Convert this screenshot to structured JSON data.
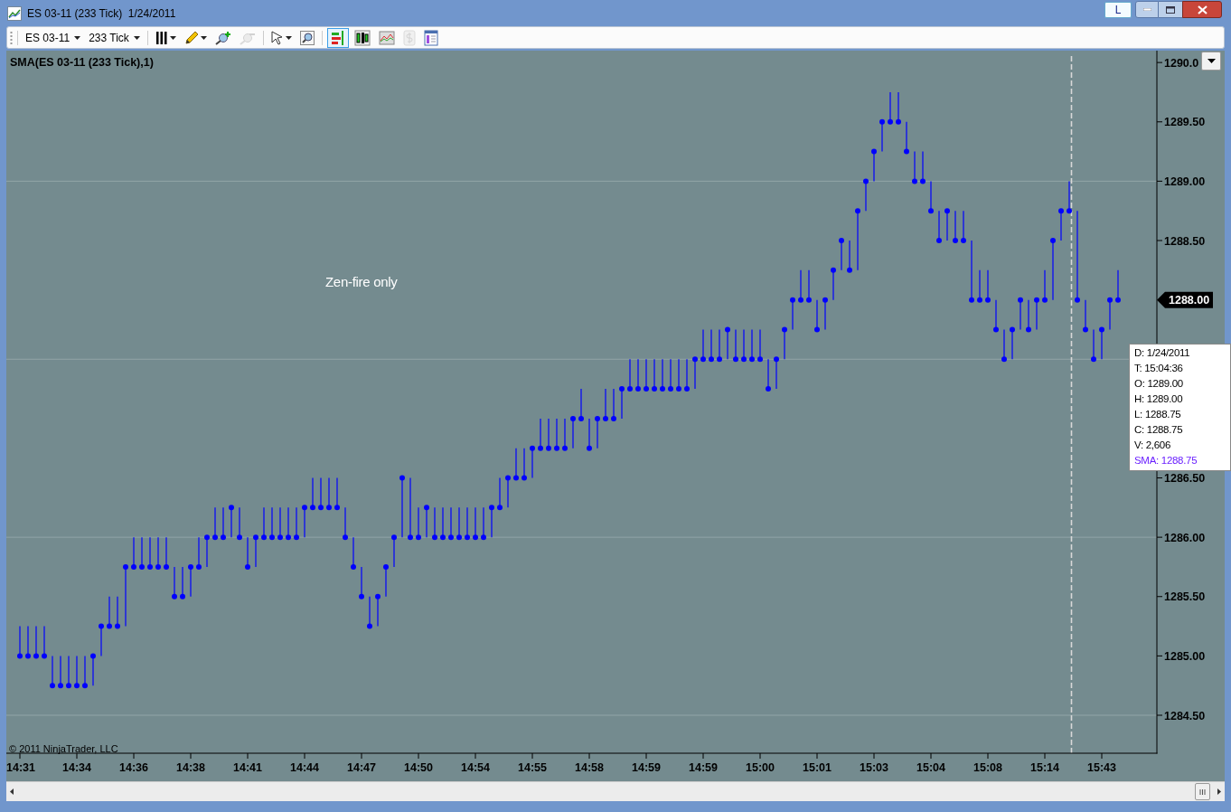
{
  "window": {
    "title": "ES 03-11 (233 Tick)  1/24/2011",
    "l_button": "L"
  },
  "toolbar": {
    "instrument": "ES 03-11",
    "period": "233 Tick",
    "tools": [
      {
        "selected": false,
        "disabled": false
      },
      {
        "selected": false,
        "disabled": false
      },
      {
        "selected": false,
        "disabled": false
      },
      {
        "selected": false,
        "disabled": true
      },
      {
        "selected": false,
        "disabled": false
      },
      {
        "selected": false,
        "disabled": false
      },
      {
        "selected": true,
        "disabled": false
      },
      {
        "selected": false,
        "disabled": false
      },
      {
        "selected": false,
        "disabled": false
      },
      {
        "selected": false,
        "disabled": true
      },
      {
        "selected": false,
        "disabled": false
      }
    ]
  },
  "chart": {
    "indicator_label": "SMA(ES 03-11 (233 Tick),1)",
    "note": "Zen-fire only",
    "copyright": "© 2011 NinjaTrader, LLC",
    "last_price": "1288.00",
    "chart_data": {
      "type": "scatter",
      "ylim": [
        1284.18,
        1290.1
      ],
      "categories": [
        "14:31",
        null,
        null,
        null,
        null,
        null,
        null,
        "14:34",
        null,
        null,
        null,
        null,
        null,
        null,
        "14:36",
        null,
        null,
        null,
        null,
        null,
        null,
        "14:38",
        null,
        null,
        null,
        null,
        null,
        null,
        "14:41",
        null,
        null,
        null,
        null,
        null,
        null,
        "14:44",
        null,
        null,
        null,
        null,
        null,
        null,
        "14:47",
        null,
        null,
        null,
        null,
        null,
        null,
        "14:50",
        null,
        null,
        null,
        null,
        null,
        null,
        "14:54",
        null,
        null,
        null,
        null,
        null,
        null,
        "14:55",
        null,
        null,
        null,
        null,
        null,
        null,
        "14:58",
        null,
        null,
        null,
        null,
        null,
        null,
        "14:59",
        null,
        null,
        null,
        null,
        null,
        null,
        "14:59",
        null,
        null,
        null,
        null,
        null,
        null,
        "15:00",
        null,
        null,
        null,
        null,
        null,
        null,
        "15:01",
        null,
        null,
        null,
        null,
        null,
        null,
        "15:03",
        null,
        null,
        null,
        null,
        null,
        null,
        "15:04",
        null,
        null,
        null,
        null,
        null,
        null,
        "15:08",
        null,
        null,
        null,
        null,
        null,
        null,
        "15:14",
        null,
        null,
        null,
        null,
        null,
        null,
        "15:43",
        null,
        null
      ],
      "yticks": [
        {
          "value": 1290,
          "label": "1290.0"
        },
        {
          "value": 1289.5,
          "label": "1289.50"
        },
        {
          "value": 1289,
          "label": "1289.00"
        },
        {
          "value": 1288.5,
          "label": "1288.50"
        },
        {
          "value": 1286.5,
          "label": "1286.50"
        },
        {
          "value": 1286,
          "label": "1286.00"
        },
        {
          "value": 1285.5,
          "label": "1285.50"
        },
        {
          "value": 1285,
          "label": "1285.00"
        },
        {
          "value": 1284.5,
          "label": "1284.50"
        }
      ],
      "grid": true,
      "series": [
        {
          "color": "#0000ff",
          "values": [
            1285,
            1285,
            1285,
            1285,
            1284.75,
            1284.75,
            1284.75,
            1284.75,
            1284.75,
            1285,
            1285.25,
            1285.25,
            1285.25,
            1285.75,
            1285.75,
            1285.75,
            1285.75,
            1285.75,
            1285.75,
            1285.5,
            1285.5,
            1285.75,
            1285.75,
            1286,
            1286,
            1286,
            1286.25,
            1286,
            1285.75,
            1286,
            1286,
            1286,
            1286,
            1286,
            1286,
            1286.25,
            1286.25,
            1286.25,
            1286.25,
            1286.25,
            1286,
            1285.75,
            1285.5,
            1285.25,
            1285.5,
            1285.75,
            1286,
            1286.5,
            1286,
            1286,
            1286.25,
            1286,
            1286,
            1286,
            1286,
            1286,
            1286,
            1286,
            1286.25,
            1286.25,
            1286.5,
            1286.5,
            1286.5,
            1286.75,
            1286.75,
            1286.75,
            1286.75,
            1286.75,
            1287,
            1287,
            1286.75,
            1287,
            1287,
            1287,
            1287.25,
            1287.25,
            1287.25,
            1287.25,
            1287.25,
            1287.25,
            1287.25,
            1287.25,
            1287.25,
            1287.5,
            1287.5,
            1287.5,
            1287.5,
            1287.75,
            1287.5,
            1287.5,
            1287.5,
            1287.5,
            1287.25,
            1287.5,
            1287.75,
            1288,
            1288,
            1288,
            1287.75,
            1288,
            1288.25,
            1288.5,
            1288.25,
            1288.75,
            1289,
            1289.25,
            1289.5,
            1289.5,
            1289.5,
            1289.25,
            1289,
            1289,
            1288.75,
            1288.5,
            1288.75,
            1288.5,
            1288.5,
            1288,
            1288,
            1288,
            1287.75,
            1287.5,
            1287.75,
            1288,
            1287.75,
            1288,
            1288,
            1288.5,
            1288.75,
            1288.75,
            1288,
            1287.75,
            1287.5,
            1287.75,
            1288,
            1288
          ],
          "errors": [
            [
              1285,
              1285.25
            ],
            [
              1285,
              1285.25
            ],
            [
              1285,
              1285.25
            ],
            [
              1285,
              1285.25
            ],
            [
              1284.75,
              1285
            ],
            [
              1284.75,
              1285
            ],
            [
              1284.75,
              1285
            ],
            [
              1284.75,
              1285
            ],
            [
              1284.75,
              1285
            ],
            [
              1284.75,
              1285
            ],
            [
              1285,
              1285.25
            ],
            [
              1285.25,
              1285.5
            ],
            [
              1285.25,
              1285.5
            ],
            [
              1285.25,
              1285.75
            ],
            [
              1285.75,
              1286
            ],
            [
              1285.75,
              1286
            ],
            [
              1285.75,
              1286
            ],
            [
              1285.75,
              1286
            ],
            [
              1285.75,
              1286
            ],
            [
              1285.5,
              1285.75
            ],
            [
              1285.5,
              1285.75
            ],
            [
              1285.5,
              1285.75
            ],
            [
              1285.75,
              1286
            ],
            [
              1285.75,
              1286
            ],
            [
              1286,
              1286.25
            ],
            [
              1286,
              1286.25
            ],
            [
              1286,
              1286.25
            ],
            [
              1286,
              1286.25
            ],
            [
              1285.75,
              1286
            ],
            [
              1285.75,
              1286
            ],
            [
              1286,
              1286.25
            ],
            [
              1286,
              1286.25
            ],
            [
              1286,
              1286.25
            ],
            [
              1286,
              1286.25
            ],
            [
              1286,
              1286.25
            ],
            [
              1286,
              1286.25
            ],
            [
              1286.25,
              1286.5
            ],
            [
              1286.25,
              1286.5
            ],
            [
              1286.25,
              1286.5
            ],
            [
              1286.25,
              1286.5
            ],
            [
              1286,
              1286.25
            ],
            [
              1285.75,
              1286
            ],
            [
              1285.5,
              1285.75
            ],
            [
              1285.25,
              1285.5
            ],
            [
              1285.25,
              1285.5
            ],
            [
              1285.5,
              1285.75
            ],
            [
              1285.75,
              1286
            ],
            [
              1286,
              1286.5
            ],
            [
              1286,
              1286.5
            ],
            [
              1286,
              1286.25
            ],
            [
              1286,
              1286.25
            ],
            [
              1286,
              1286.25
            ],
            [
              1286,
              1286.25
            ],
            [
              1286,
              1286.25
            ],
            [
              1286,
              1286.25
            ],
            [
              1286,
              1286.25
            ],
            [
              1286,
              1286.25
            ],
            [
              1286,
              1286.25
            ],
            [
              1286,
              1286.25
            ],
            [
              1286.25,
              1286.5
            ],
            [
              1286.25,
              1286.5
            ],
            [
              1286.5,
              1286.75
            ],
            [
              1286.5,
              1286.75
            ],
            [
              1286.5,
              1286.75
            ],
            [
              1286.75,
              1287
            ],
            [
              1286.75,
              1287
            ],
            [
              1286.75,
              1287
            ],
            [
              1286.75,
              1287
            ],
            [
              1286.75,
              1287
            ],
            [
              1287,
              1287.25
            ],
            [
              1286.75,
              1287
            ],
            [
              1286.75,
              1287
            ],
            [
              1287,
              1287.25
            ],
            [
              1287,
              1287.25
            ],
            [
              1287,
              1287.25
            ],
            [
              1287.25,
              1287.5
            ],
            [
              1287.25,
              1287.5
            ],
            [
              1287.25,
              1287.5
            ],
            [
              1287.25,
              1287.5
            ],
            [
              1287.25,
              1287.5
            ],
            [
              1287.25,
              1287.5
            ],
            [
              1287.25,
              1287.5
            ],
            [
              1287.25,
              1287.5
            ],
            [
              1287.25,
              1287.5
            ],
            [
              1287.5,
              1287.75
            ],
            [
              1287.5,
              1287.75
            ],
            [
              1287.5,
              1287.75
            ],
            [
              1287.5,
              1287.75
            ],
            [
              1287.5,
              1287.75
            ],
            [
              1287.5,
              1287.75
            ],
            [
              1287.5,
              1287.75
            ],
            [
              1287.5,
              1287.75
            ],
            [
              1287.25,
              1287.5
            ],
            [
              1287.25,
              1287.5
            ],
            [
              1287.5,
              1287.75
            ],
            [
              1287.75,
              1288
            ],
            [
              1288,
              1288.25
            ],
            [
              1288,
              1288.25
            ],
            [
              1287.75,
              1288
            ],
            [
              1287.75,
              1288
            ],
            [
              1288,
              1288.25
            ],
            [
              1288.25,
              1288.5
            ],
            [
              1288.25,
              1288.5
            ],
            [
              1288.25,
              1288.75
            ],
            [
              1288.75,
              1289
            ],
            [
              1289,
              1289.25
            ],
            [
              1289.25,
              1289.5
            ],
            [
              1289.5,
              1289.75
            ],
            [
              1289.5,
              1289.75
            ],
            [
              1289.25,
              1289.5
            ],
            [
              1289,
              1289.25
            ],
            [
              1289,
              1289.25
            ],
            [
              1288.75,
              1289
            ],
            [
              1288.5,
              1288.75
            ],
            [
              1288.5,
              1288.75
            ],
            [
              1288.5,
              1288.75
            ],
            [
              1288.5,
              1288.75
            ],
            [
              1288,
              1288.5
            ],
            [
              1288,
              1288.25
            ],
            [
              1288,
              1288.25
            ],
            [
              1287.75,
              1288
            ],
            [
              1287.5,
              1287.75
            ],
            [
              1287.5,
              1287.75
            ],
            [
              1287.75,
              1288
            ],
            [
              1287.75,
              1288
            ],
            [
              1287.75,
              1288
            ],
            [
              1288,
              1288.25
            ],
            [
              1288,
              1288.5
            ],
            [
              1288.5,
              1288.75
            ],
            [
              1288.75,
              1289
            ],
            [
              1288,
              1288.75
            ],
            [
              1287.75,
              1288
            ],
            [
              1287.5,
              1287.75
            ],
            [
              1287.5,
              1287.75
            ],
            [
              1287.75,
              1288
            ],
            [
              1288,
              1288.25
            ]
          ]
        }
      ]
    },
    "tooltip": [
      {
        "text": "D: 1/24/2011",
        "kind": "value"
      },
      {
        "text": "T: 15:04:36",
        "kind": "value"
      },
      {
        "text": "O: 1289.00",
        "kind": "value"
      },
      {
        "text": "H: 1289.00",
        "kind": "value"
      },
      {
        "text": "L: 1288.75",
        "kind": "value"
      },
      {
        "text": "C: 1288.75",
        "kind": "value"
      },
      {
        "text": "V: 2,606",
        "kind": "value"
      },
      {
        "text": "SMA: 1288.75",
        "kind": "indicator"
      }
    ]
  }
}
